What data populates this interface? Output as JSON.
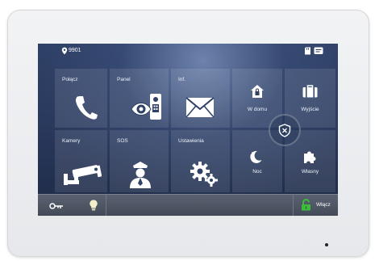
{
  "status_bar": {
    "room_number": "9901",
    "location_icon": "location-pin-icon",
    "right_icons": [
      "sd-card-icon",
      "message-icon"
    ]
  },
  "tiles": [
    {
      "label": "Połącz",
      "icon": "phone-icon"
    },
    {
      "label": "Panel",
      "icon": "door-panel-camera-icon"
    },
    {
      "label": "Inf.",
      "icon": "envelope-icon"
    },
    {
      "label": "Kamery",
      "icon": "cctv-camera-icon"
    },
    {
      "label": "SOS",
      "icon": "security-guard-icon"
    },
    {
      "label": "Ustawienia",
      "icon": "gears-icon"
    }
  ],
  "security_modes": [
    {
      "label": "W domu",
      "icon": "home-lock-icon"
    },
    {
      "label": "Wyjście",
      "icon": "briefcase-icon"
    },
    {
      "label": "Noc",
      "icon": "moon-icon"
    },
    {
      "label": "Własny",
      "icon": "puzzle-icon"
    }
  ],
  "center_icon": "shield-icon",
  "bottom_bar": {
    "left_icons": [
      "key-icon",
      "lightbulb-icon"
    ],
    "unlock_icon": "padlock-icon",
    "unlock_color": "#3dbb3d",
    "unlock_label": "Włącz"
  }
}
